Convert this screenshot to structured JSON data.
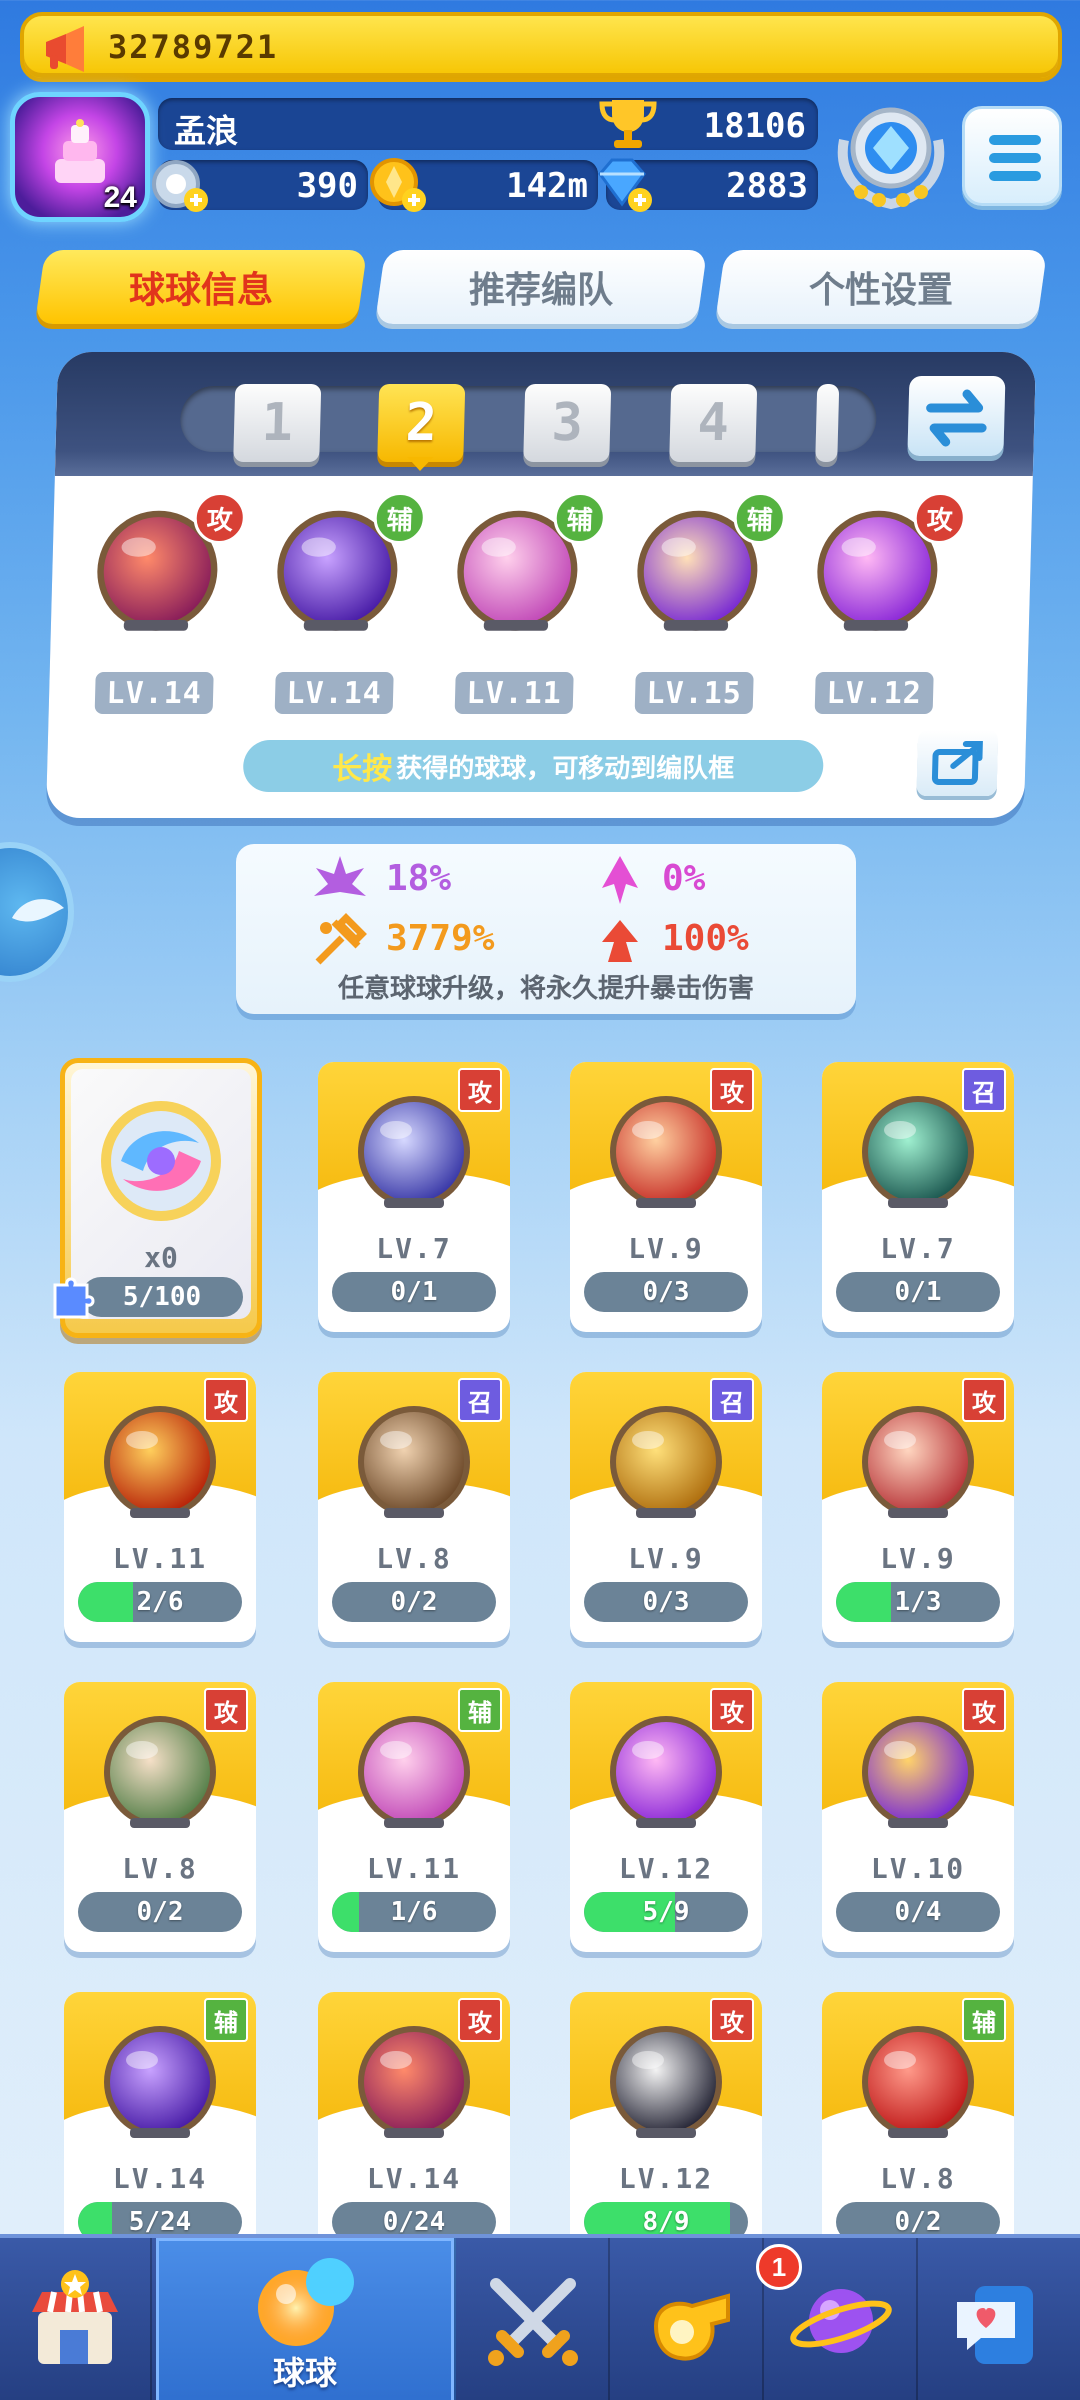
{
  "broadcast": {
    "text": "32789721",
    "icon": "megaphone-icon"
  },
  "player": {
    "name": "孟浪",
    "level": "24",
    "trophies": "18106"
  },
  "resources": [
    {
      "icon": "energy-icon",
      "value": "390"
    },
    {
      "icon": "coin-icon",
      "value": "142m"
    },
    {
      "icon": "diamond-icon",
      "value": "2883"
    }
  ],
  "tabs": [
    {
      "label": "球球信息",
      "active": true
    },
    {
      "label": "推荐编队",
      "active": false
    },
    {
      "label": "个性设置",
      "active": false
    }
  ],
  "team": {
    "slots": [
      "1",
      "2",
      "3",
      "4"
    ],
    "active_slot": "2",
    "balls": [
      {
        "level": "LV.14",
        "badge": "攻",
        "type": "attack",
        "icon": "infinity-ball-icon"
      },
      {
        "level": "LV.14",
        "badge": "辅",
        "type": "support",
        "icon": "lightning-ball-icon"
      },
      {
        "level": "LV.11",
        "badge": "辅",
        "type": "support",
        "icon": "shield-ball-icon"
      },
      {
        "level": "LV.15",
        "badge": "辅",
        "type": "support",
        "icon": "clone-ball-icon"
      },
      {
        "level": "LV.12",
        "badge": "攻",
        "type": "attack",
        "icon": "shark-ball-icon"
      }
    ],
    "hint_highlight": "长按",
    "hint_text": "获得的球球，可移动到编队框"
  },
  "stats": {
    "crit_rate": "18%",
    "bonus": "0%",
    "crit_damage": "3779%",
    "damage": "100%",
    "note": "任意球球升级，将永久提升暴击伤害"
  },
  "special_card": {
    "count": "x0",
    "progress_text": "5/100",
    "progress": 0.05
  },
  "cards": [
    {
      "level": "LV.7",
      "badge": "攻",
      "type": "attack",
      "progress_text": "0/1",
      "progress": 0,
      "icon": "angel-ball-icon"
    },
    {
      "level": "LV.9",
      "badge": "攻",
      "type": "attack",
      "progress_text": "0/3",
      "progress": 0,
      "icon": "monkey-king-ball-icon"
    },
    {
      "level": "LV.7",
      "badge": "召",
      "type": "summon",
      "progress_text": "0/1",
      "progress": 0,
      "icon": "spiral-ball-icon"
    },
    {
      "level": "LV.11",
      "badge": "攻",
      "type": "attack",
      "progress_text": "2/6",
      "progress": 0.333,
      "icon": "fire-ball-icon"
    },
    {
      "level": "LV.8",
      "badge": "召",
      "type": "summon",
      "progress_text": "0/2",
      "progress": 0,
      "icon": "monkey-ball-icon"
    },
    {
      "level": "LV.9",
      "badge": "召",
      "type": "summon",
      "progress_text": "0/3",
      "progress": 0,
      "icon": "bear-briar-ball-icon"
    },
    {
      "level": "LV.9",
      "badge": "攻",
      "type": "attack",
      "progress_text": "1/3",
      "progress": 0.333,
      "icon": "bear-bramble-ball-icon"
    },
    {
      "level": "LV.8",
      "badge": "攻",
      "type": "attack",
      "progress_text": "0/2",
      "progress": 0,
      "icon": "woodcutter-ball-icon"
    },
    {
      "level": "LV.11",
      "badge": "辅",
      "type": "support",
      "progress_text": "1/6",
      "progress": 0.167,
      "icon": "shield-ball-icon"
    },
    {
      "level": "LV.12",
      "badge": "攻",
      "type": "attack",
      "progress_text": "5/9",
      "progress": 0.556,
      "icon": "shark-ball-icon"
    },
    {
      "level": "LV.10",
      "badge": "攻",
      "type": "attack",
      "progress_text": "0/4",
      "progress": 0,
      "icon": "dinosaur-ball-icon"
    },
    {
      "level": "LV.14",
      "badge": "辅",
      "type": "support",
      "progress_text": "5/24",
      "progress": 0.208,
      "icon": "lightning-ball-icon"
    },
    {
      "level": "LV.14",
      "badge": "攻",
      "type": "attack",
      "progress_text": "0/24",
      "progress": 0,
      "icon": "infinity-ball-icon"
    },
    {
      "level": "LV.12",
      "badge": "攻",
      "type": "attack",
      "progress_text": "8/9",
      "progress": 0.889,
      "icon": "opera-mask-ball-icon"
    },
    {
      "level": "LV.8",
      "badge": "辅",
      "type": "support",
      "progress_text": "0/2",
      "progress": 0,
      "icon": "red-envelope-ball-icon"
    }
  ],
  "nav": [
    {
      "icon": "shop-icon",
      "label": ""
    },
    {
      "icon": "balls-icon",
      "label": "球球",
      "active": true
    },
    {
      "icon": "battle-swords-icon",
      "label": ""
    },
    {
      "icon": "whistle-icon",
      "label": "",
      "badge": "1"
    },
    {
      "icon": "planet-icon",
      "label": ""
    },
    {
      "icon": "chat-icon",
      "label": ""
    }
  ],
  "colors": {
    "attack": "#d84035",
    "support": "#55b340",
    "summon": "#6e5ce0",
    "accent": "#ffc400"
  }
}
